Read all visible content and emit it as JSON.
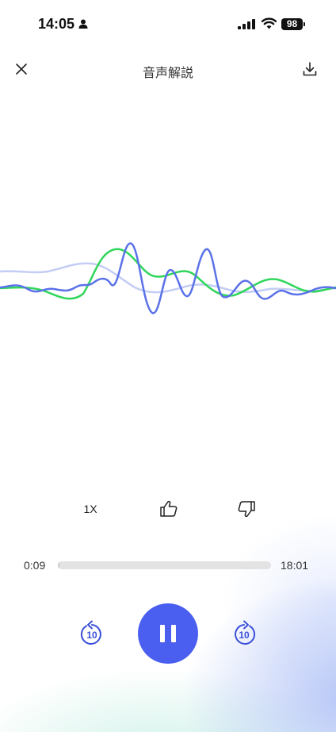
{
  "status_bar": {
    "time": "14:05",
    "battery": "98",
    "icons": [
      "person-icon",
      "signal-icon",
      "wifi-icon",
      "battery-icon"
    ]
  },
  "header": {
    "title": "音声解説",
    "close_icon": "close-icon",
    "download_icon": "download-icon"
  },
  "waveform": {
    "colors": {
      "green": "#2fd65b",
      "blue": "#5b72e8",
      "faint": "#c3cdf5"
    }
  },
  "controls": {
    "speed_label": "1X",
    "like_icon": "thumbs-up-icon",
    "dislike_icon": "thumbs-down-icon"
  },
  "progress": {
    "current": "0:09",
    "total": "18:01",
    "fraction": 0.008
  },
  "playback": {
    "rewind_label": "10",
    "forward_label": "10",
    "accent_color": "#4a5ff0",
    "state": "playing"
  }
}
